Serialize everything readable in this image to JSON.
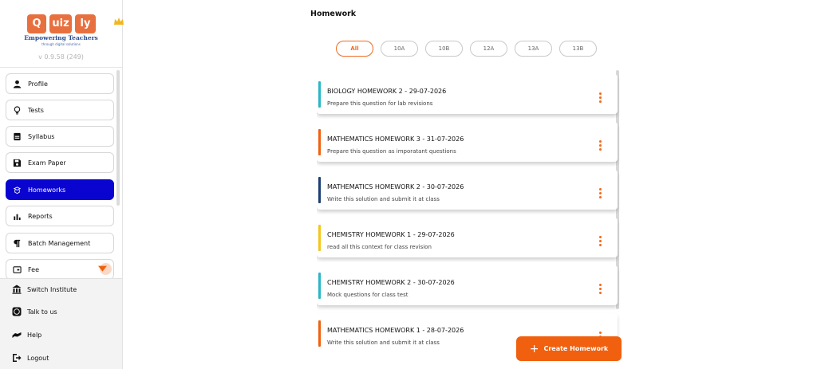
{
  "brand": {
    "logo_tiles": [
      "Q",
      "uiz",
      "ly"
    ],
    "tagline": "Empowering Teachers",
    "tagline_sub": "through digital solutions",
    "version": "v 0.9.58 (249)",
    "accent": "#e8703f"
  },
  "sidebar": {
    "items": [
      {
        "label": "Profile",
        "icon": "person-icon"
      },
      {
        "label": "Tests",
        "icon": "lightbulb-icon"
      },
      {
        "label": "Syllabus",
        "icon": "book-icon"
      },
      {
        "label": "Exam Paper",
        "icon": "floppy-disk-icon"
      },
      {
        "label": "Homeworks",
        "icon": "homework-icon",
        "active": true
      },
      {
        "label": "Reports",
        "icon": "bar-chart-icon"
      },
      {
        "label": "Batch Management",
        "icon": "paragraph-icon"
      },
      {
        "label": "Fee",
        "icon": "fee-icon"
      }
    ],
    "bottom_items": [
      {
        "label": "Switch Institute",
        "icon": "institute-icon"
      },
      {
        "label": "Talk to us",
        "icon": "whatsapp-icon"
      },
      {
        "label": "Help",
        "icon": "help-hands-icon"
      },
      {
        "label": "Logout",
        "icon": "logout-icon"
      }
    ],
    "active_color": "#0a04d0"
  },
  "main": {
    "title": "Homework",
    "filters": [
      "All",
      "10A",
      "10B",
      "12A",
      "13A",
      "13B"
    ],
    "selected_filter": "All",
    "homeworks": [
      {
        "title": "BIOLOGY HOMEWORK 2 - 29-07-2026",
        "description": "Prepare this question for lab revisions",
        "color": "#29b6c6"
      },
      {
        "title": "MATHEMATICS HOMEWORK 3 - 31-07-2026",
        "description": "Prepare this question as imporatant questions",
        "color": "#f0600f"
      },
      {
        "title": "MATHEMATICS HOMEWORK 2 - 30-07-2026",
        "description": "Write this solution and submit it at class",
        "color": "#1c3f73"
      },
      {
        "title": "CHEMISTRY HOMEWORK 1 - 29-07-2026",
        "description": "read all this context for class revision",
        "color": "#f5c518"
      },
      {
        "title": "CHEMISTRY HOMEWORK 2 - 30-07-2026",
        "description": "Mock questions for class test",
        "color": "#29b6c6"
      },
      {
        "title": "MATHEMATICS HOMEWORK 1 - 28-07-2026",
        "description": "Write this solution and submit it at class",
        "color": "#f0600f"
      }
    ],
    "create_button": "Create Homework",
    "accent": "#f0600f"
  }
}
